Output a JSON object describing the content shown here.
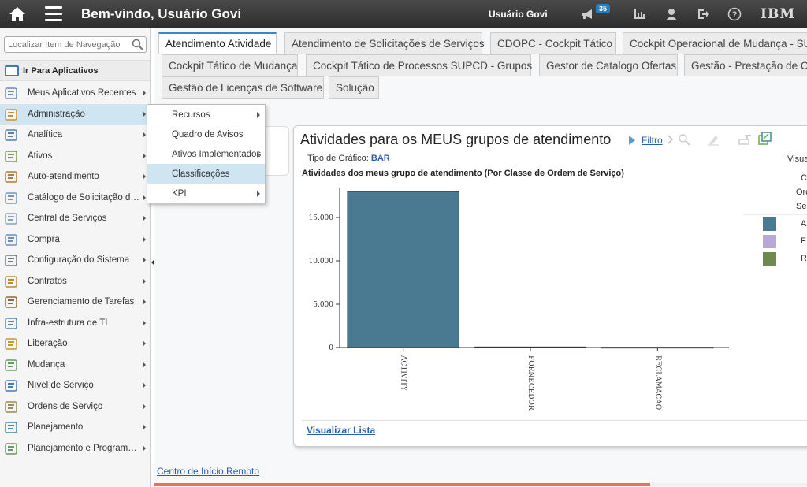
{
  "topbar": {
    "title": "Bem-vindo, Usuário Govi",
    "user": "Usuário Govi",
    "notifications": "35",
    "brand": "IBM",
    "icons": [
      "home-icon",
      "menu-icon",
      "megaphone-icon",
      "chart-icon",
      "user-icon",
      "logout-icon",
      "help-icon"
    ]
  },
  "leftnav": {
    "search_placeholder": "Localizar Item de Navegação",
    "go_apps": "Ir Para Aplicativos",
    "items": [
      {
        "label": "Meus Aplicativos Recentes"
      },
      {
        "label": "Administração"
      },
      {
        "label": "Analítica"
      },
      {
        "label": "Ativos"
      },
      {
        "label": "Auto-atendimento"
      },
      {
        "label": "Catálogo de Solicitação de ..."
      },
      {
        "label": "Central de Serviços"
      },
      {
        "label": "Compra"
      },
      {
        "label": "Configuração do Sistema"
      },
      {
        "label": "Contratos"
      },
      {
        "label": "Gerenciamento de Tarefas"
      },
      {
        "label": "Infra-estrutura de TI"
      },
      {
        "label": "Liberação"
      },
      {
        "label": "Mudança"
      },
      {
        "label": "Nível de Serviço"
      },
      {
        "label": "Ordens de Serviço"
      },
      {
        "label": "Planejamento"
      },
      {
        "label": "Planejamento e Programação"
      }
    ]
  },
  "flyout": {
    "items": [
      {
        "label": "Recursos"
      },
      {
        "label": "Quadro de Avisos"
      },
      {
        "label": "Ativos Implementados"
      },
      {
        "label": "Classificações"
      },
      {
        "label": "KPI"
      }
    ]
  },
  "tabs": [
    {
      "label": "Atendimento Atividade"
    },
    {
      "label": "Atendimento de Solicitações de Serviços"
    },
    {
      "label": "CDOPC - Cockpit Tático"
    },
    {
      "label": "Cockpit Operacional de Mudança - SUF"
    },
    {
      "label": "Cockpit Tático de Mudança"
    },
    {
      "label": "Cockpit Tático de Processos SUPCD - Grupos"
    },
    {
      "label": "Gestor de Catalogo Ofertas"
    },
    {
      "label": "Gestão - Prestação de Co"
    },
    {
      "label": "Gestão de Licenças de Software"
    },
    {
      "label": "Solução"
    }
  ],
  "portlet": {
    "title": "Atividades para os MEUS grupos de atendimento",
    "filter": "Filtro",
    "visual_label": "Visua",
    "chart_type_label": "Tipo de Gráfico:",
    "chart_type_value": "BAR",
    "view_list": "Visualizar Lista",
    "legend_header": [
      "C",
      "Ord",
      "Ser"
    ],
    "legend": [
      {
        "label": "A",
        "color": "#4a7a92"
      },
      {
        "label": "F",
        "color": "#b7a8d8"
      },
      {
        "label": "R",
        "color": "#6f8a4e"
      }
    ]
  },
  "chart_data": {
    "type": "bar",
    "title": "Atividades dos meus grupo de atendimento (Por Classe de Ordem de Serviço)",
    "categories": [
      "ACTIVITY",
      "FORNECEDOR",
      "RECLAMACAO"
    ],
    "values": [
      18200,
      60,
      30
    ],
    "ylim": [
      0,
      18000
    ],
    "yticks": [
      "0",
      "5.000",
      "10.000",
      "15.000"
    ],
    "ytick_values": [
      0,
      5000,
      10000,
      15000
    ],
    "color": "#4a7a92"
  },
  "footer": {
    "remote_link": "Centro de Início Remoto",
    "progress": 0.76
  }
}
